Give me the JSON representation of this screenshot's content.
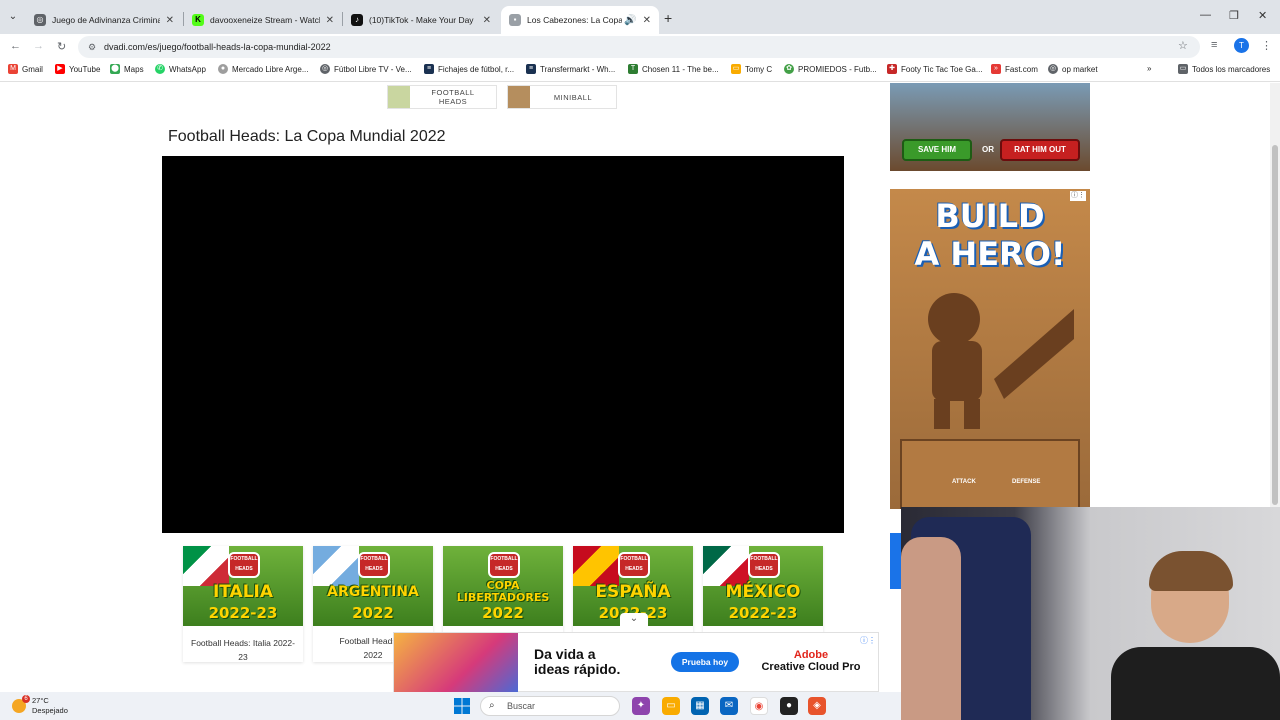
{
  "browser": {
    "tabs": [
      {
        "title": "Juego de Adivinanza Criminal",
        "favicon": "globe-icon",
        "active": false
      },
      {
        "title": "davooxeneize Stream - Watch L",
        "favicon": "kick-icon",
        "active": false
      },
      {
        "title": "(10)TikTok - Make Your Day",
        "favicon": "tiktok-icon",
        "active": false
      },
      {
        "title": "Los Cabezones: La Copa Mu",
        "favicon": "dvadi-icon",
        "active": true,
        "audio": true
      }
    ],
    "new_tab": "+",
    "url": "dvadi.com/es/juego/football-heads-la-copa-mundial-2022",
    "profile_initial": "T",
    "bookmarks": [
      {
        "label": "Gmail",
        "icon": "gmail-icon"
      },
      {
        "label": "YouTube",
        "icon": "youtube-icon"
      },
      {
        "label": "Maps",
        "icon": "maps-icon"
      },
      {
        "label": "WhatsApp",
        "icon": "whatsapp-icon"
      },
      {
        "label": "Mercado Libre Arge...",
        "icon": "mercadolibre-icon"
      },
      {
        "label": "Fútbol Libre TV - Ve...",
        "icon": "globe-icon"
      },
      {
        "label": "Fichajes de fútbol, r...",
        "icon": "transfermarkt-icon"
      },
      {
        "label": "Transfermarkt - Wh...",
        "icon": "transfermarkt-icon"
      },
      {
        "label": "Chosen 11 - The be...",
        "icon": "chosen11-icon"
      },
      {
        "label": "Tomy C",
        "icon": "folder-icon"
      },
      {
        "label": "PROMIEDOS - Futb...",
        "icon": "promiedos-icon"
      },
      {
        "label": "Footy Tic Tac Toe Ga...",
        "icon": "footy-icon"
      },
      {
        "label": "Fast.com",
        "icon": "fast-icon"
      },
      {
        "label": "op market",
        "icon": "globe-icon"
      }
    ],
    "all_bookmarks": "Todos los marcadores"
  },
  "page": {
    "top_cards": [
      {
        "label": "FOOTBALL\nHEADS"
      },
      {
        "label": "MINIBALL"
      }
    ],
    "game_title": "Football Heads: La Copa Mundial 2022",
    "related_games": [
      {
        "name": "ITALIA",
        "year": "2022-23",
        "caption": "Football Heads: Italia 2022-23",
        "flag": "italy"
      },
      {
        "name": "ARGENTINA",
        "year": "2022",
        "caption": "Football Heads: A",
        "caption2": "2022",
        "flag": "argentina"
      },
      {
        "name": "COPA\nLIBERTADORES",
        "year": "2022",
        "caption": "",
        "flag": "none"
      },
      {
        "name": "ESPAÑA",
        "year": "2022-23",
        "caption": "",
        "flag": "spain"
      },
      {
        "name": "MÉXICO",
        "year": "2022-23",
        "caption": "",
        "flag": "mexico"
      }
    ],
    "badge_text": "FOOTBALL\nHEADS"
  },
  "ads": {
    "top": {
      "save_label": "SAVE HIM",
      "or_label": "OR",
      "rat_label": "RAT HIM OUT"
    },
    "hero": {
      "title_line1": "BUILD",
      "title_line2": "A HERO!",
      "attack": "ATTACK",
      "defense": "DEFENSE"
    },
    "bottom": {
      "tagline": "Da vida a ideas rápido.",
      "cta": "Prueba hoy",
      "brand1": "Adobe",
      "brand2": "Creative Cloud Pro"
    }
  },
  "taskbar": {
    "temperature": "27°C",
    "condition": "Despejado",
    "notification_count": "6",
    "search_placeholder": "Buscar"
  },
  "colors": {
    "tabstrip": "#dfe3e8",
    "accent": "#1a73e8",
    "game_bg": "#000000",
    "ad_cta": "#1473e6"
  }
}
